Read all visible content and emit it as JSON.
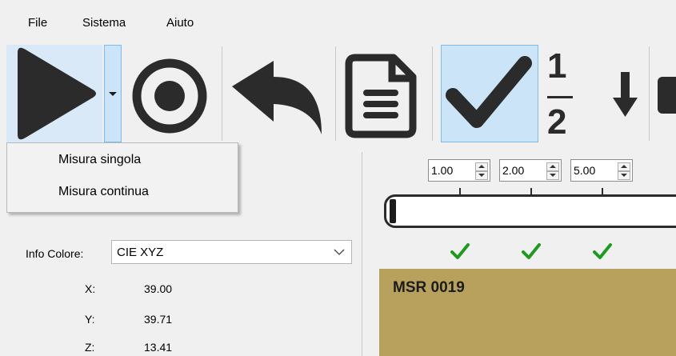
{
  "menu": {
    "file": "File",
    "sistema": "Sistema",
    "aiuto": "Aiuto"
  },
  "toolbar": {
    "buttons": [
      "play-icon",
      "record-icon",
      "undo-icon",
      "document-icon",
      "checkmark-icon",
      "fraction-icon",
      "arrow-down-icon",
      "stop-icon"
    ],
    "number_one": "1",
    "number_two": "2"
  },
  "dropdown": {
    "items": [
      "Misura singola",
      "Misura continua"
    ]
  },
  "info": {
    "label": "Info Colore:",
    "selected": "CIE XYZ",
    "rows": [
      {
        "label": "X:",
        "value": "39.00"
      },
      {
        "label": "Y:",
        "value": "39.71"
      },
      {
        "label": "Z:",
        "value": "13.41"
      }
    ]
  },
  "spinners": [
    "1.00",
    "2.00",
    "5.00"
  ],
  "swatch": {
    "label": "MSR 0019",
    "color": "#b8a15d"
  },
  "colors": {
    "accent_check": "#1e9b1e",
    "toolbar_active": "#cce4f7"
  }
}
